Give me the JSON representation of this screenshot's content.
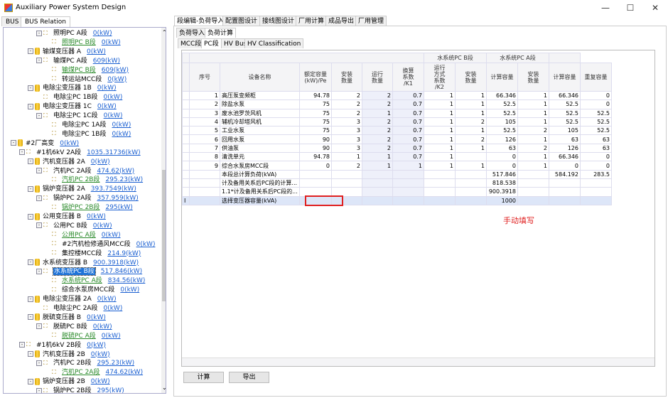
{
  "window": {
    "title": "Auxiliary Power System Design",
    "minimize": "—",
    "maximize": "☐",
    "close": "✕"
  },
  "left_tabs": [
    "BUS",
    "BUS Relation"
  ],
  "tree": [
    {
      "level": 4,
      "type": "bus",
      "exp": "-",
      "label": "照明PC A段",
      "value": "0(kW)",
      "style": ""
    },
    {
      "level": 5,
      "type": "bus",
      "label": "照明PC B段",
      "value": "0(kW)",
      "style": "green"
    },
    {
      "level": 3,
      "type": "tr",
      "exp": "-",
      "label": "输煤变压器 A",
      "value": "0(kW)",
      "style": ""
    },
    {
      "level": 4,
      "type": "bus",
      "exp": "-",
      "label": "输煤PC A段",
      "value": "609(kW)",
      "style": ""
    },
    {
      "level": 5,
      "type": "bus",
      "label": "输煤PC B段",
      "value": "609(kW)",
      "style": "green"
    },
    {
      "level": 5,
      "type": "bus",
      "label": "转运站MCC段",
      "value": "0(kW)",
      "style": ""
    },
    {
      "level": 3,
      "type": "tr",
      "exp": "-",
      "label": "电除尘变压器 1B",
      "value": "0(kW)",
      "style": ""
    },
    {
      "level": 4,
      "type": "bus",
      "label": "电除尘PC 1B段",
      "value": "0(kW)",
      "style": ""
    },
    {
      "level": 3,
      "type": "tr",
      "exp": "-",
      "label": "电除尘变压器 1C",
      "value": "0(kW)",
      "style": ""
    },
    {
      "level": 4,
      "type": "bus",
      "exp": "-",
      "label": "电除尘PC 1C段",
      "value": "0(kW)",
      "style": ""
    },
    {
      "level": 5,
      "type": "bus",
      "label": "电除尘PC 1A段",
      "value": "0(kW)",
      "style": ""
    },
    {
      "level": 5,
      "type": "bus",
      "label": "电除尘PC 1B段",
      "value": "0(kW)",
      "style": ""
    },
    {
      "level": 1,
      "type": "tr",
      "exp": "-",
      "label": "#2厂高变",
      "value": "0(kW)",
      "style": ""
    },
    {
      "level": 2,
      "type": "bus",
      "exp": "-",
      "label": "#1机6kV 2A段",
      "value": "1035.31736(kW)",
      "style": ""
    },
    {
      "level": 3,
      "type": "tr",
      "exp": "-",
      "label": "汽机变压器 2A",
      "value": "0(kW)",
      "style": ""
    },
    {
      "level": 4,
      "type": "bus",
      "exp": "-",
      "label": "汽机PC 2A段",
      "value": "474.62(kW)",
      "style": ""
    },
    {
      "level": 5,
      "type": "bus",
      "label": "汽机PC 2B段",
      "value": "295.23(kW)",
      "style": "green"
    },
    {
      "level": 3,
      "type": "tr",
      "exp": "-",
      "label": "锅炉变压器 2A",
      "value": "393.7549(kW)",
      "style": ""
    },
    {
      "level": 4,
      "type": "bus",
      "exp": "-",
      "label": "锅炉PC 2A段",
      "value": "357.959(kW)",
      "style": ""
    },
    {
      "level": 5,
      "type": "bus",
      "label": "锅炉PC 2B段",
      "value": "295(kW)",
      "style": "green"
    },
    {
      "level": 3,
      "type": "tr",
      "exp": "-",
      "label": "公用变压器 B",
      "value": "0(kW)",
      "style": ""
    },
    {
      "level": 4,
      "type": "bus",
      "exp": "-",
      "label": "公用PC B段",
      "value": "0(kW)",
      "style": ""
    },
    {
      "level": 5,
      "type": "bus",
      "label": "公用PC A段",
      "value": "0(kW)",
      "style": "green"
    },
    {
      "level": 5,
      "type": "bus",
      "label": "#2汽机检修通风MCC段",
      "value": "0(kW)",
      "style": ""
    },
    {
      "level": 5,
      "type": "bus",
      "label": "集控楼MCC段",
      "value": "214.9(kW)",
      "style": ""
    },
    {
      "level": 3,
      "type": "tr",
      "exp": "-",
      "label": "水系统变压器 B",
      "value": "900.3918(kW)",
      "style": ""
    },
    {
      "level": 4,
      "type": "bus",
      "exp": "-",
      "label": "水系统PC B段",
      "value": "517.846(kW)",
      "style": "sel"
    },
    {
      "level": 5,
      "type": "bus",
      "label": "水系统PC A段",
      "value": "834.56(kW)",
      "style": "green"
    },
    {
      "level": 5,
      "type": "bus",
      "label": "综合水泵房MCC段",
      "value": "0(kW)",
      "style": ""
    },
    {
      "level": 3,
      "type": "tr",
      "exp": "-",
      "label": "电除尘变压器 2A",
      "value": "0(kW)",
      "style": ""
    },
    {
      "level": 4,
      "type": "bus",
      "label": "电除尘PC 2A段",
      "value": "0(kW)",
      "style": ""
    },
    {
      "level": 3,
      "type": "tr",
      "exp": "-",
      "label": "脱硫变压器 B",
      "value": "0(kW)",
      "style": ""
    },
    {
      "level": 4,
      "type": "bus",
      "exp": "-",
      "label": "脱硫PC B段",
      "value": "0(kW)",
      "style": ""
    },
    {
      "level": 5,
      "type": "bus",
      "label": "脱硫PC A段",
      "value": "0(kW)",
      "style": "green"
    },
    {
      "level": 2,
      "type": "bus",
      "exp": "-",
      "label": "#1机6kV 2B段",
      "value": "0(kW)",
      "style": ""
    },
    {
      "level": 3,
      "type": "tr",
      "exp": "-",
      "label": "汽机变压器 2B",
      "value": "0(kW)",
      "style": ""
    },
    {
      "level": 4,
      "type": "bus",
      "exp": "-",
      "label": "汽机PC 2B段",
      "value": "295.23(kW)",
      "style": ""
    },
    {
      "level": 5,
      "type": "bus",
      "label": "汽机PC 2A段",
      "value": "474.62(kW)",
      "style": "green"
    },
    {
      "level": 3,
      "type": "tr",
      "exp": "-",
      "label": "锅炉变压器 2B",
      "value": "0(kW)",
      "style": ""
    },
    {
      "level": 4,
      "type": "bus",
      "exp": "-",
      "label": "锅炉PC 2B段",
      "value": "295(kW)",
      "style": ""
    }
  ],
  "top_tabs": [
    "段编辑-负荷导入",
    "配置图设计",
    "接线图设计",
    "厂用计算",
    "成品导出",
    "厂用管理"
  ],
  "sub_tabs": [
    "负荷导入",
    "负荷计算"
  ],
  "seg_tabs": [
    "MCC段",
    "PC段",
    "HV Bus",
    "HV Classification"
  ],
  "grid": {
    "group_headers": {
      "pcb": "水系统PC B段",
      "pca": "水系统PC A段"
    },
    "headers": [
      "序号",
      "设备名称",
      "额定容量\n(kW)/Pe",
      "安装\n数量",
      "运行\n数量",
      "换算\n系数\n/K1",
      "运行\n方式\n系数\n/K2",
      "安装\n数量",
      "计算容量",
      "安装\n数量",
      "计算容量",
      "重复容量"
    ],
    "rows": [
      [
        "1",
        "高压泵变频柜",
        "94.78",
        "2",
        "2",
        "0.7",
        "1",
        "1",
        "66.346",
        "1",
        "66.346",
        "0"
      ],
      [
        "2",
        "除盐水泵",
        "75",
        "2",
        "2",
        "0.7",
        "1",
        "1",
        "52.5",
        "1",
        "52.5",
        "0"
      ],
      [
        "3",
        "废水池罗茨风机",
        "75",
        "2",
        "1",
        "0.7",
        "1",
        "1",
        "52.5",
        "1",
        "52.5",
        "52.5"
      ],
      [
        "4",
        "辅机冷却塔风机",
        "75",
        "3",
        "2",
        "0.7",
        "1",
        "2",
        "105",
        "1",
        "52.5",
        "52.5"
      ],
      [
        "5",
        "工业水泵",
        "75",
        "3",
        "2",
        "0.7",
        "1",
        "1",
        "52.5",
        "2",
        "105",
        "52.5"
      ],
      [
        "6",
        "回用水泵",
        "90",
        "3",
        "2",
        "0.7",
        "1",
        "2",
        "126",
        "1",
        "63",
        "63"
      ],
      [
        "7",
        "供油泵",
        "90",
        "3",
        "2",
        "0.7",
        "1",
        "1",
        "63",
        "2",
        "126",
        "63"
      ],
      [
        "8",
        "清洗单元",
        "94.78",
        "1",
        "1",
        "0.7",
        "1",
        "",
        "0",
        "1",
        "66.346",
        "0"
      ],
      [
        "9",
        "综合水泵房MCC段",
        "0",
        "2",
        "1",
        "1",
        "1",
        "1",
        "0",
        "1",
        "0",
        "0"
      ],
      [
        "",
        "本段总计算负荷(kVA)",
        "",
        "",
        "",
        "",
        "",
        "",
        "517.846",
        "",
        "584.192",
        "283.5"
      ],
      [
        "",
        "计及备用关系后PC段的计算...",
        "",
        "",
        "",
        "",
        "",
        "",
        "818.538",
        "",
        "",
        ""
      ],
      [
        "",
        "1.1*计及备用关系后PC段的...",
        "",
        "",
        "",
        "",
        "",
        "",
        "900.3918",
        "",
        "",
        ""
      ],
      [
        "",
        "选择变压器容量(kVA)",
        "",
        "",
        "",
        "",
        "",
        "",
        "1000",
        "",
        "",
        ""
      ]
    ],
    "current_row_marker": "I"
  },
  "annotation": "手动填写",
  "buttons": {
    "calc": "计算",
    "export": "导出"
  }
}
